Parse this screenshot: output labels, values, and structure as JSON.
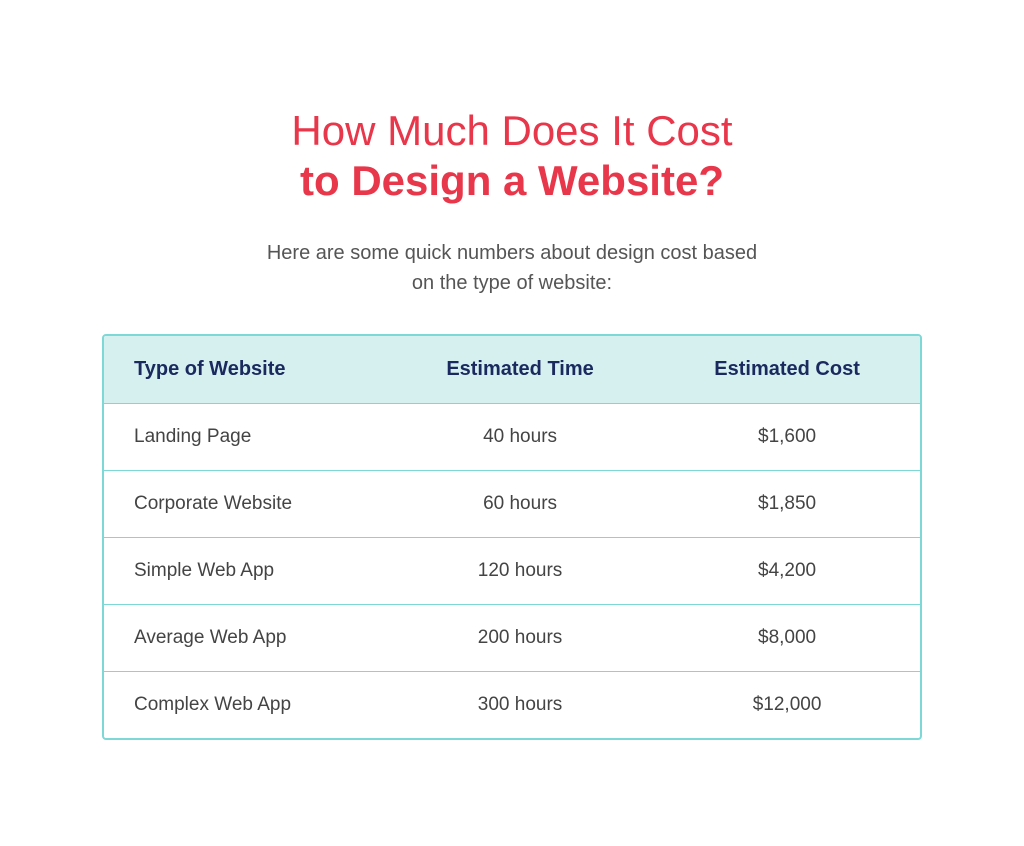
{
  "title": {
    "line1": "How Much Does It Cost",
    "line2": "to Design a Website?"
  },
  "subtitle": "Here are some quick numbers about design cost based\non the type of website:",
  "table": {
    "headers": [
      "Type of Website",
      "Estimated Time",
      "Estimated Cost"
    ],
    "rows": [
      [
        "Landing Page",
        "40 hours",
        "$1,600"
      ],
      [
        "Corporate Website",
        "60 hours",
        "$1,850"
      ],
      [
        "Simple Web App",
        "120 hours",
        "$4,200"
      ],
      [
        "Average Web App",
        "200 hours",
        "$8,000"
      ],
      [
        "Complex Web App",
        "300 hours",
        "$12,000"
      ]
    ]
  }
}
